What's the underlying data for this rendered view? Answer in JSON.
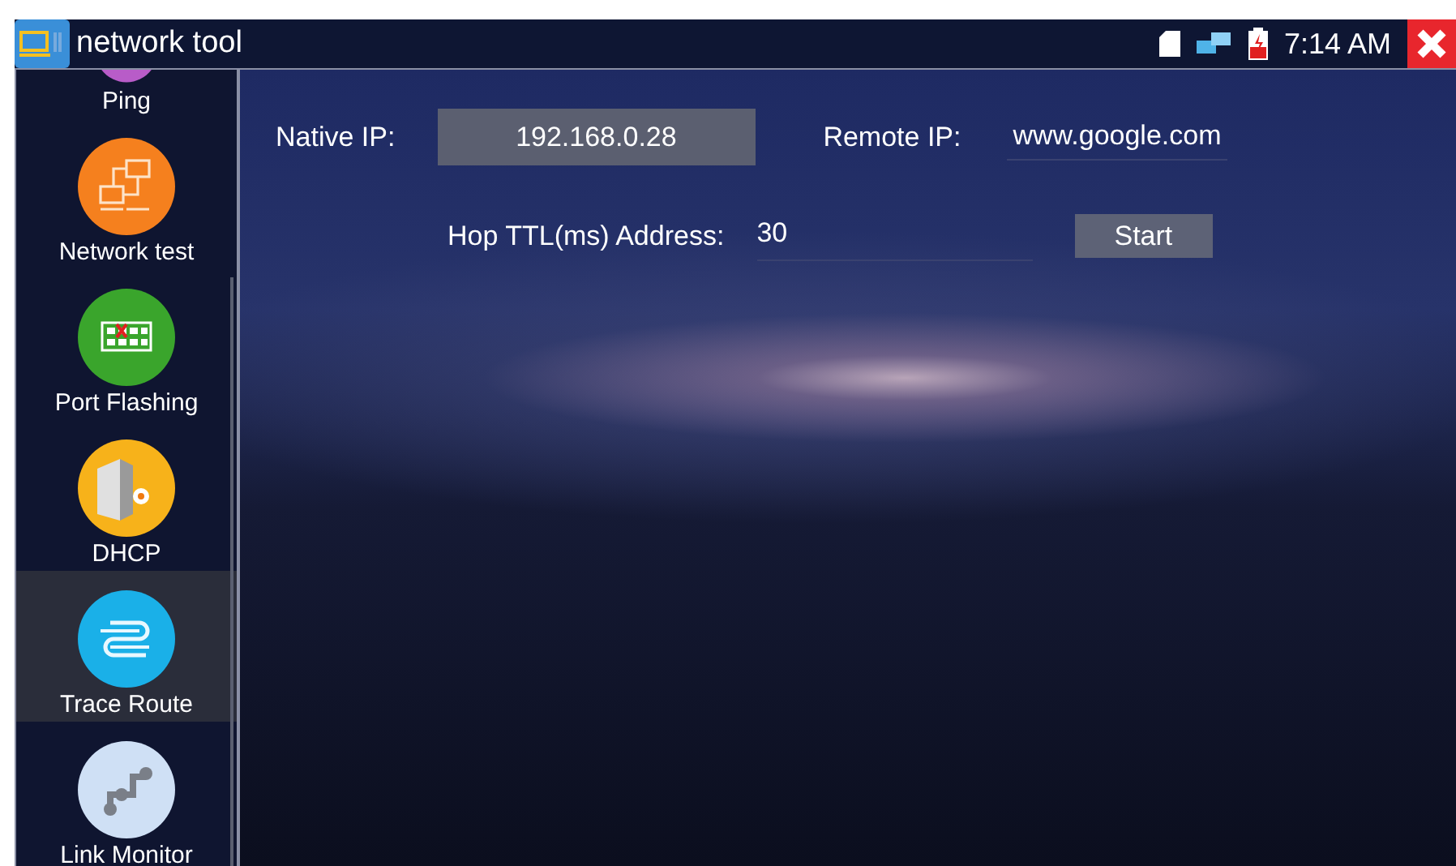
{
  "window": {
    "title": "network tool"
  },
  "status_bar": {
    "time": "7:14 AM"
  },
  "sidebar": {
    "items": [
      {
        "label": "Ping",
        "selected": false
      },
      {
        "label": "Network test",
        "selected": false
      },
      {
        "label": "Port Flashing",
        "selected": false
      },
      {
        "label": "DHCP",
        "selected": false
      },
      {
        "label": "Trace Route",
        "selected": true
      },
      {
        "label": "Link Monitor",
        "selected": false
      }
    ]
  },
  "form": {
    "native_ip": {
      "label": "Native IP:",
      "value": "192.168.0.28"
    },
    "remote_ip": {
      "label": "Remote IP:",
      "value": "www.google.com"
    },
    "hop_ttl": {
      "label": "Hop TTL(ms) Address:",
      "value": "30"
    },
    "start_button": "Start"
  }
}
